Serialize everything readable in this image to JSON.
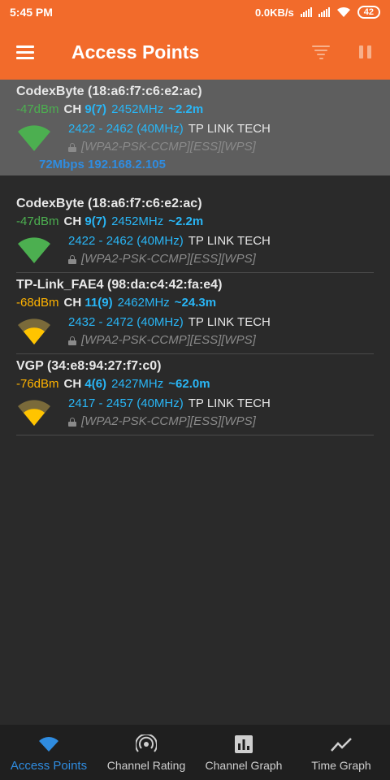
{
  "status": {
    "time": "5:45 PM",
    "speed": "0.0KB/s",
    "battery": "42"
  },
  "appbar": {
    "title": "Access Points",
    "icons": [
      "menu-icon",
      "filter-icon",
      "pause-icon"
    ]
  },
  "access_points": [
    {
      "ssid": "CodexByte (18:a6:f7:c6:e2:ac)",
      "dbm": "-47dBm",
      "ch_label": "CH",
      "ch": "9(7)",
      "freq": "2452MHz",
      "distance": "~2.2m",
      "range": "2422 - 2462 (40MHz)",
      "vendor": "TP LINK TECH",
      "security": "[WPA2-PSK-CCMP][ESS][WPS]",
      "connection": "72Mbps 192.168.2.105",
      "selected": true,
      "signal_color": "#4caf50"
    },
    {
      "ssid": "CodexByte (18:a6:f7:c6:e2:ac)",
      "dbm": "-47dBm",
      "ch_label": "CH",
      "ch": "9(7)",
      "freq": "2452MHz",
      "distance": "~2.2m",
      "range": "2422 - 2462 (40MHz)",
      "vendor": "TP LINK TECH",
      "security": "[WPA2-PSK-CCMP][ESS][WPS]",
      "signal_color": "#4caf50"
    },
    {
      "ssid": "TP-Link_FAE4 (98:da:c4:42:fa:e4)",
      "dbm": "-68dBm",
      "ch_label": "CH",
      "ch": "11(9)",
      "freq": "2462MHz",
      "distance": "~24.3m",
      "range": "2432 - 2472 (40MHz)",
      "vendor": "TP LINK TECH",
      "security": "[WPA2-PSK-CCMP][ESS][WPS]",
      "signal_color": "#ffb300"
    },
    {
      "ssid": "VGP (34:e8:94:27:f7:c0)",
      "dbm": "-76dBm",
      "ch_label": "CH",
      "ch": "4(6)",
      "freq": "2427MHz",
      "distance": "~62.0m",
      "range": "2417 - 2457 (40MHz)",
      "vendor": "TP LINK TECH",
      "security": "[WPA2-PSK-CCMP][ESS][WPS]",
      "signal_color": "#ffb300"
    }
  ],
  "bottom_nav": [
    {
      "label": "Access Points",
      "icon": "wifi-icon",
      "active": true
    },
    {
      "label": "Channel Rating",
      "icon": "radar-icon"
    },
    {
      "label": "Channel Graph",
      "icon": "bar-chart-icon"
    },
    {
      "label": "Time Graph",
      "icon": "line-chart-icon"
    }
  ],
  "colors": {
    "appbar": "#f26b2b",
    "background": "#2a2a2a",
    "accent_blue": "#29b6f6",
    "strong_signal": "#4caf50",
    "medium_signal": "#ffb300"
  }
}
